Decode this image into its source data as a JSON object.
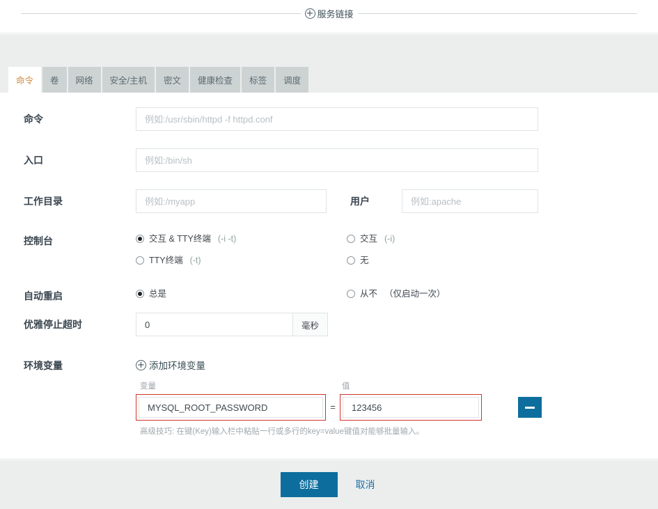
{
  "service_link": {
    "icon": "circle-plus-icon",
    "label": "服务链接"
  },
  "tabs": [
    {
      "label": "命令",
      "active": true
    },
    {
      "label": "卷",
      "active": false
    },
    {
      "label": "网络",
      "active": false
    },
    {
      "label": "安全/主机",
      "active": false
    },
    {
      "label": "密文",
      "active": false
    },
    {
      "label": "健康检查",
      "active": false
    },
    {
      "label": "标签",
      "active": false
    },
    {
      "label": "调度",
      "active": false
    }
  ],
  "form": {
    "command": {
      "label": "命令",
      "value": "",
      "placeholder": "例如:/usr/sbin/httpd -f httpd.conf"
    },
    "entrypoint": {
      "label": "入口",
      "value": "",
      "placeholder": "例如:/bin/sh"
    },
    "workdir": {
      "label": "工作目录",
      "value": "",
      "placeholder": "例如:/myapp"
    },
    "user": {
      "label": "用户",
      "value": "",
      "placeholder": "例如:apache"
    },
    "console": {
      "label": "控制台",
      "options": [
        {
          "text": "交互 & TTY终端",
          "flag": "(-i -t)",
          "checked": true
        },
        {
          "text": "交互",
          "flag": "(-i)",
          "checked": false
        },
        {
          "text": "TTY终端",
          "flag": "(-t)",
          "checked": false
        },
        {
          "text": "无",
          "flag": "",
          "checked": false
        }
      ]
    },
    "restart": {
      "label": "自动重启",
      "options": [
        {
          "text": "总是",
          "note": "",
          "checked": true
        },
        {
          "text": "从不",
          "note": "（仅启动一次）",
          "checked": false
        }
      ]
    },
    "stop_grace": {
      "label": "优雅停止超时",
      "value": "0",
      "unit": "毫秒"
    },
    "env": {
      "label": "环境变量",
      "add_label": "添加环境变量",
      "add_icon": "circle-plus-icon",
      "key_caption": "变量",
      "value_caption": "值",
      "separator": "=",
      "remove_icon": "minus-icon",
      "rows": [
        {
          "key": "MYSQL_ROOT_PASSWORD",
          "value": "123456"
        }
      ],
      "tip": "高级技巧: 在键(Key)输入栏中粘贴一行或多行的key=value键值对能够批量输入。"
    }
  },
  "footer": {
    "create_label": "创建",
    "cancel_label": "取消"
  },
  "colors": {
    "primary": "#0d6e9e",
    "tab_active_text": "#d18a3d",
    "tab_bg": "#cdd3d3",
    "band_bg": "#eceeed",
    "highlight": "#d0342c",
    "link": "#1a6fa8"
  }
}
